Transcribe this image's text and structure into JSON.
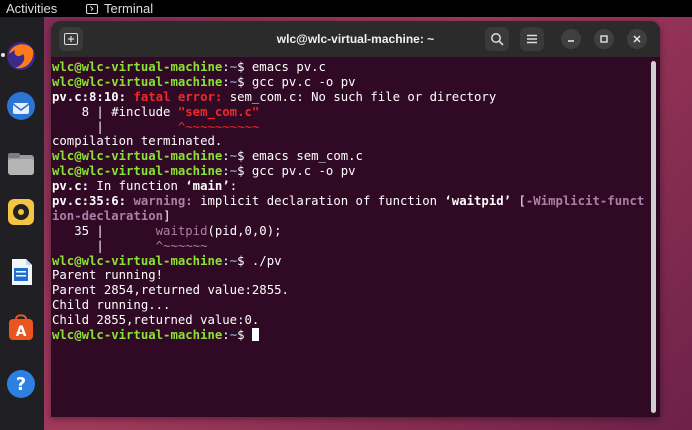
{
  "topbar": {
    "activities": "Activities",
    "app": "Terminal"
  },
  "dock": [
    {
      "name": "firefox-icon"
    },
    {
      "name": "thunderbird-icon"
    },
    {
      "name": "files-icon"
    },
    {
      "name": "rhythmbox-icon"
    },
    {
      "name": "writer-icon"
    },
    {
      "name": "software-icon"
    },
    {
      "name": "help-icon"
    }
  ],
  "window": {
    "title": "wlc@wlc-virtual-machine: ~"
  },
  "terminal": {
    "prompt_user": "wlc@wlc-virtual-machine",
    "prompt_sep": ":",
    "prompt_path": "~",
    "prompt_dollar": "$",
    "cmd1": " emacs pv.c",
    "cmd2": " gcc pv.c -o pv",
    "err_loc": "pv.c:8:10:",
    "err_kind": " fatal error:",
    "err_msg": " sem_com.c: No such file or directory",
    "src1_prefix": "    8 | #include ",
    "src1_str": "\"sem_com.c\"",
    "caret1_prefix": "      |          ",
    "caret1": "^~~~~~~~~~~",
    "term_msg": "compilation terminated.",
    "cmd3": " emacs sem_com.c",
    "cmd4": " gcc pv.c -o pv",
    "fn_loc": "pv.c:",
    "fn_msg": " In function ",
    "fn_name": "‘main’",
    "fn_colon": ":",
    "warn_loc": "pv.c:35:6:",
    "warn_kind": " warning:",
    "warn_msg": " implicit declaration of function ",
    "warn_fn": "‘waitpid’",
    "warn_open": " [",
    "warn_flag1": "-Wimplicit-funct",
    "warn_flag2": "ion-declaration",
    "warn_close": "]",
    "src2_prefix": "   35 |       ",
    "src2_fn": "waitpid",
    "src2_rest": "(pid,0,0);",
    "caret2_prefix": "      |       ",
    "caret2": "^~~~~~~",
    "cmd5": " ./pv",
    "out1": "Parent running!",
    "out2": "Parent 2854,returned value:2855.",
    "out3": "Child running...",
    "out4": "Child 2855,returned value:0."
  }
}
